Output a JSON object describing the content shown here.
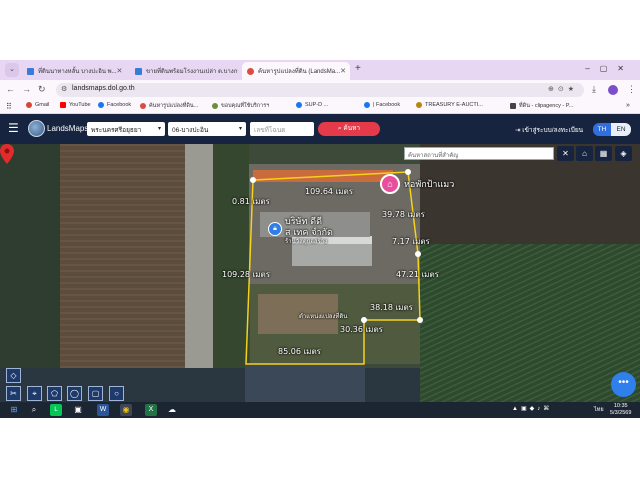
{
  "browser": {
    "tabs": [
      {
        "label": "ที่ดินนาทางหลั้น บางปะอิน พ...",
        "icon": "home-icon",
        "active": false
      },
      {
        "label": "ขายที่ดินพร้อมโรงงานเปล่า ต.บางกระ...",
        "icon": "home-icon",
        "active": false
      },
      {
        "label": "ค้นหารูปแปลงที่ดิน (LandsMa...",
        "icon": "map-pin-icon",
        "active": true
      }
    ],
    "new_tab": "+",
    "url": "landsmaps.dol.go.th",
    "bookmarks": [
      {
        "label": "Gmail",
        "color": "#d44638"
      },
      {
        "label": "YouTube",
        "color": "#ff0000"
      },
      {
        "label": "Facebook",
        "color": "#1877f2"
      },
      {
        "label": "ค้นหารูปแปลงที่ดิน...",
        "color": "#e04b3f"
      },
      {
        "label": "ขอบคุณที่ใช้บริการฯ",
        "color": "#6a8f3a"
      },
      {
        "label": "SUP-D ...",
        "color": "#1877f2"
      },
      {
        "label": "| Facebook",
        "color": "#1877f2"
      },
      {
        "label": "TREASURY E-AUCTI...",
        "color": "#b8860b"
      },
      {
        "label": "ที่ดิน - clipagency - P...",
        "color": "#444444"
      }
    ]
  },
  "app": {
    "brand": "LandsMaps",
    "province": "พระนครศรีอยุธยา",
    "district": "06-บางปะอิน",
    "deed_placeholder": "เลขที่โฉนด",
    "search_label": "ค้นหา",
    "login_label": "เข้าสู่ระบบ/ลงทะเบียน",
    "lang_th": "TH",
    "lang_en": "EN",
    "place_search_placeholder": "ค้นหาสถานที่สำคัญ"
  },
  "map": {
    "labels": {
      "north_top": "109.64 เมตร",
      "west_small": "0.81 เมตร",
      "east_top": "39.78 เมตร",
      "east_mid": "7.17 เมตร",
      "west": "109.28 เมตร",
      "east_lower": "47.21 เมตร",
      "inner_east": "38.18 เมตร",
      "inner_south": "30.36 เมตร",
      "south": "85.06 เมตร",
      "poi": "หอพักป้าแมว",
      "company_line1": "บริษัท ดีดี",
      "company_line2": "ส เทค จำกัด",
      "company_line3": "ร้านวัสดุก่อสร้าง",
      "pin_label": "ตำแหน่งแปลงที่ดิน"
    }
  },
  "taskbar": {
    "time": "10:35",
    "date": "5/3/2569",
    "lang": "ไทย"
  }
}
